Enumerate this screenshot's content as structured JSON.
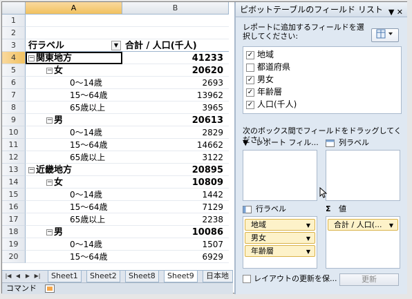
{
  "sheet": {
    "columns": [
      "A",
      "B"
    ],
    "rows": [
      {
        "num": "1",
        "a": "",
        "b": ""
      },
      {
        "num": "2",
        "a": "",
        "b": ""
      },
      {
        "num": "3",
        "a": "行ラベル",
        "b": "合計 / 人口(千人)"
      },
      {
        "num": "4",
        "a": "関東地方",
        "b": "41233"
      },
      {
        "num": "5",
        "a": "女",
        "b": "20620"
      },
      {
        "num": "6",
        "a": "0～14歳",
        "b": "2693"
      },
      {
        "num": "7",
        "a": "15～64歳",
        "b": "13962"
      },
      {
        "num": "8",
        "a": "65歳以上",
        "b": "3965"
      },
      {
        "num": "9",
        "a": "男",
        "b": "20613"
      },
      {
        "num": "10",
        "a": "0～14歳",
        "b": "2829"
      },
      {
        "num": "11",
        "a": "15～64歳",
        "b": "14662"
      },
      {
        "num": "12",
        "a": "65歳以上",
        "b": "3122"
      },
      {
        "num": "13",
        "a": "近畿地方",
        "b": "20895"
      },
      {
        "num": "14",
        "a": "女",
        "b": "10809"
      },
      {
        "num": "15",
        "a": "0～14歳",
        "b": "1442"
      },
      {
        "num": "16",
        "a": "15～64歳",
        "b": "7129"
      },
      {
        "num": "17",
        "a": "65歳以上",
        "b": "2238"
      },
      {
        "num": "18",
        "a": "男",
        "b": "10086"
      },
      {
        "num": "19",
        "a": "0～14歳",
        "b": "1507"
      },
      {
        "num": "20",
        "a": "15～64歳",
        "b": "6929"
      }
    ],
    "collapse_symbol": "−",
    "filter_symbol": "▼"
  },
  "tabs": {
    "sheets": [
      "Sheet1",
      "Sheet2",
      "Sheet8",
      "Sheet9",
      "日本地"
    ],
    "active": "Sheet9"
  },
  "status": {
    "mode": "コマンド"
  },
  "pane": {
    "title": "ピボットテーブルのフィールド リスト",
    "title_controls": "▼ ✕",
    "choose_label": "レポートに追加するフィールドを選択してください:",
    "fields": [
      {
        "name": "地域",
        "checked": "✓"
      },
      {
        "name": "都道府県",
        "checked": ""
      },
      {
        "name": "男女",
        "checked": "✓"
      },
      {
        "name": "年齢層",
        "checked": "✓"
      },
      {
        "name": "人口(千人)",
        "checked": "✓"
      }
    ],
    "drag_label": "次のボックス間でフィールドをドラッグしてください:",
    "areas": {
      "report_filter": "レポート フィル...",
      "column_labels": "列ラベル",
      "row_labels": "行ラベル",
      "values": "値"
    },
    "row_chips": [
      "地域",
      "男女",
      "年齢層"
    ],
    "value_chips": [
      "合計 / 人口(..."
    ],
    "defer_label": "レイアウトの更新を保...",
    "update_button": "更新",
    "sigma": "Σ"
  }
}
